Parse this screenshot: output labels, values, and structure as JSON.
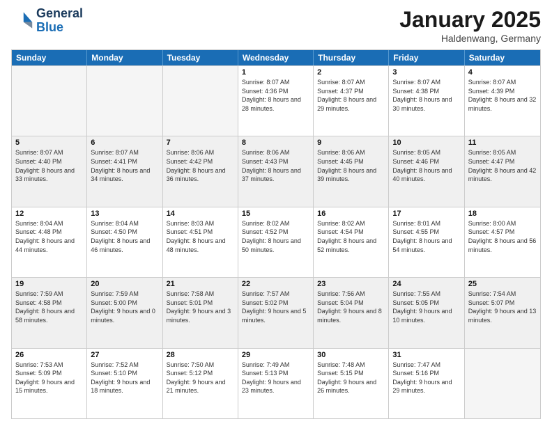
{
  "header": {
    "logo_general": "General",
    "logo_blue": "Blue",
    "title": "January 2025",
    "location": "Haldenwang, Germany"
  },
  "days_of_week": [
    "Sunday",
    "Monday",
    "Tuesday",
    "Wednesday",
    "Thursday",
    "Friday",
    "Saturday"
  ],
  "weeks": [
    [
      {
        "day": "",
        "empty": true
      },
      {
        "day": "",
        "empty": true
      },
      {
        "day": "",
        "empty": true
      },
      {
        "day": "1",
        "sunrise": "8:07 AM",
        "sunset": "4:36 PM",
        "daylight": "8 hours and 28 minutes."
      },
      {
        "day": "2",
        "sunrise": "8:07 AM",
        "sunset": "4:37 PM",
        "daylight": "8 hours and 29 minutes."
      },
      {
        "day": "3",
        "sunrise": "8:07 AM",
        "sunset": "4:38 PM",
        "daylight": "8 hours and 30 minutes."
      },
      {
        "day": "4",
        "sunrise": "8:07 AM",
        "sunset": "4:39 PM",
        "daylight": "8 hours and 32 minutes."
      }
    ],
    [
      {
        "day": "5",
        "sunrise": "8:07 AM",
        "sunset": "4:40 PM",
        "daylight": "8 hours and 33 minutes."
      },
      {
        "day": "6",
        "sunrise": "8:07 AM",
        "sunset": "4:41 PM",
        "daylight": "8 hours and 34 minutes."
      },
      {
        "day": "7",
        "sunrise": "8:06 AM",
        "sunset": "4:42 PM",
        "daylight": "8 hours and 36 minutes."
      },
      {
        "day": "8",
        "sunrise": "8:06 AM",
        "sunset": "4:43 PM",
        "daylight": "8 hours and 37 minutes."
      },
      {
        "day": "9",
        "sunrise": "8:06 AM",
        "sunset": "4:45 PM",
        "daylight": "8 hours and 39 minutes."
      },
      {
        "day": "10",
        "sunrise": "8:05 AM",
        "sunset": "4:46 PM",
        "daylight": "8 hours and 40 minutes."
      },
      {
        "day": "11",
        "sunrise": "8:05 AM",
        "sunset": "4:47 PM",
        "daylight": "8 hours and 42 minutes."
      }
    ],
    [
      {
        "day": "12",
        "sunrise": "8:04 AM",
        "sunset": "4:48 PM",
        "daylight": "8 hours and 44 minutes."
      },
      {
        "day": "13",
        "sunrise": "8:04 AM",
        "sunset": "4:50 PM",
        "daylight": "8 hours and 46 minutes."
      },
      {
        "day": "14",
        "sunrise": "8:03 AM",
        "sunset": "4:51 PM",
        "daylight": "8 hours and 48 minutes."
      },
      {
        "day": "15",
        "sunrise": "8:02 AM",
        "sunset": "4:52 PM",
        "daylight": "8 hours and 50 minutes."
      },
      {
        "day": "16",
        "sunrise": "8:02 AM",
        "sunset": "4:54 PM",
        "daylight": "8 hours and 52 minutes."
      },
      {
        "day": "17",
        "sunrise": "8:01 AM",
        "sunset": "4:55 PM",
        "daylight": "8 hours and 54 minutes."
      },
      {
        "day": "18",
        "sunrise": "8:00 AM",
        "sunset": "4:57 PM",
        "daylight": "8 hours and 56 minutes."
      }
    ],
    [
      {
        "day": "19",
        "sunrise": "7:59 AM",
        "sunset": "4:58 PM",
        "daylight": "8 hours and 58 minutes."
      },
      {
        "day": "20",
        "sunrise": "7:59 AM",
        "sunset": "5:00 PM",
        "daylight": "9 hours and 0 minutes."
      },
      {
        "day": "21",
        "sunrise": "7:58 AM",
        "sunset": "5:01 PM",
        "daylight": "9 hours and 3 minutes."
      },
      {
        "day": "22",
        "sunrise": "7:57 AM",
        "sunset": "5:02 PM",
        "daylight": "9 hours and 5 minutes."
      },
      {
        "day": "23",
        "sunrise": "7:56 AM",
        "sunset": "5:04 PM",
        "daylight": "9 hours and 8 minutes."
      },
      {
        "day": "24",
        "sunrise": "7:55 AM",
        "sunset": "5:05 PM",
        "daylight": "9 hours and 10 minutes."
      },
      {
        "day": "25",
        "sunrise": "7:54 AM",
        "sunset": "5:07 PM",
        "daylight": "9 hours and 13 minutes."
      }
    ],
    [
      {
        "day": "26",
        "sunrise": "7:53 AM",
        "sunset": "5:09 PM",
        "daylight": "9 hours and 15 minutes."
      },
      {
        "day": "27",
        "sunrise": "7:52 AM",
        "sunset": "5:10 PM",
        "daylight": "9 hours and 18 minutes."
      },
      {
        "day": "28",
        "sunrise": "7:50 AM",
        "sunset": "5:12 PM",
        "daylight": "9 hours and 21 minutes."
      },
      {
        "day": "29",
        "sunrise": "7:49 AM",
        "sunset": "5:13 PM",
        "daylight": "9 hours and 23 minutes."
      },
      {
        "day": "30",
        "sunrise": "7:48 AM",
        "sunset": "5:15 PM",
        "daylight": "9 hours and 26 minutes."
      },
      {
        "day": "31",
        "sunrise": "7:47 AM",
        "sunset": "5:16 PM",
        "daylight": "9 hours and 29 minutes."
      },
      {
        "day": "",
        "empty": true
      }
    ]
  ]
}
